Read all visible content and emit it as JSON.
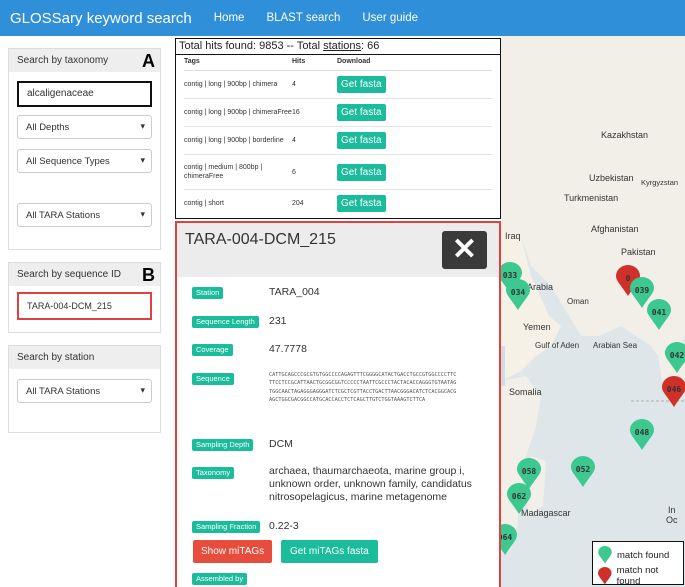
{
  "navbar": {
    "brand": "GLOSSary keyword search",
    "links": [
      "Home",
      "BLAST search",
      "User guide"
    ]
  },
  "sidebar": {
    "taxonomy": {
      "title": "Search by taxonomy",
      "letter": "A",
      "input_value": "alcaligenaceae",
      "depths": "All Depths",
      "types": "All Sequence Types",
      "stations": "All TARA Stations"
    },
    "seqid": {
      "title": "Search by sequence ID",
      "letter": "B",
      "input_value": "TARA-004-DCM_215"
    },
    "station": {
      "title": "Search by station",
      "stations": "All TARA Stations"
    }
  },
  "hits": {
    "prefix": "Total hits found: 9853 -- Total ",
    "stations_link": "stations",
    "suffix": ": 66",
    "columns": [
      "Tags",
      "Hits",
      "Download"
    ],
    "rows": [
      {
        "tag": "contig | long | 900bp | chimera",
        "hits": "4",
        "button": "Get fasta"
      },
      {
        "tag": "contig | long | 900bp | chimeraFree",
        "hits": "16",
        "button": "Get fasta"
      },
      {
        "tag": "contig | long | 900bp | borderline",
        "hits": "4",
        "button": "Get fasta"
      },
      {
        "tag": "contig | medium | 800bp | chimeraFree",
        "hits": "6",
        "button": "Get fasta"
      },
      {
        "tag": "contig | short",
        "hits": "204",
        "button": "Get fasta"
      }
    ]
  },
  "card": {
    "title": "TARA-004-DCM_215",
    "station_label": "Station",
    "station": "TARA_004",
    "length_label": "Sequence Length",
    "length": "231",
    "coverage_label": "Coverage",
    "coverage": "47.7778",
    "sequence_label": "Sequence",
    "sequence": "CATTGCAGCCCGCGTGTGGCCCCAGAGTTTCGGGGCATACTGACCTGCCGTGGCCCCTTCTTCCTCCGCATTAACTGCGGCGGTCCCCCTAATTCGCCCTACTACACCAGGGTGTAATAGTGGCAACTAGAGGGAGGGATCTCGCTCGTTACCTGACTTAACGGGACATCTCACGGCACGAGCTGGCGACGGCCATGCACCACCTCTCAGCTTGTCTGGTAAAGTCTTCA",
    "depth_label": "Sampling Depth",
    "depth": "DCM",
    "taxonomy_label": "Taxonomy",
    "taxonomy": "archaea, thaumarchaeota, marine group i, unknown order, unknown family, candidatus nitrosopelagicus, marine metagenome",
    "fraction_label": "Sampling Fraction",
    "fraction": "0.22-3",
    "show_button": "Show miTAGs",
    "get_button": "Get miTAGs fasta",
    "assembled_label": "Assembled by"
  },
  "map": {
    "labels": [
      "Kazakhstan",
      "Uzbekistan",
      "Kyrgyzstan",
      "Turkmenistan",
      "Afghanistan",
      "Iraq",
      "Pakistan",
      "Arabia",
      "Oman",
      "Yemen",
      "Gulf of Aden",
      "Arabian Sea",
      "Somalia",
      "Madagascar",
      "In",
      "Oc"
    ],
    "green_pins": [
      "033",
      "034",
      "039",
      "041",
      "042",
      "048",
      "058",
      "052",
      "062",
      "064"
    ],
    "red_pins": [
      "0",
      "046"
    ],
    "match_color": "#3cc88f",
    "nomatch_color": "#d0302a"
  },
  "legend": {
    "found": "match found",
    "not_found": "match not found"
  }
}
